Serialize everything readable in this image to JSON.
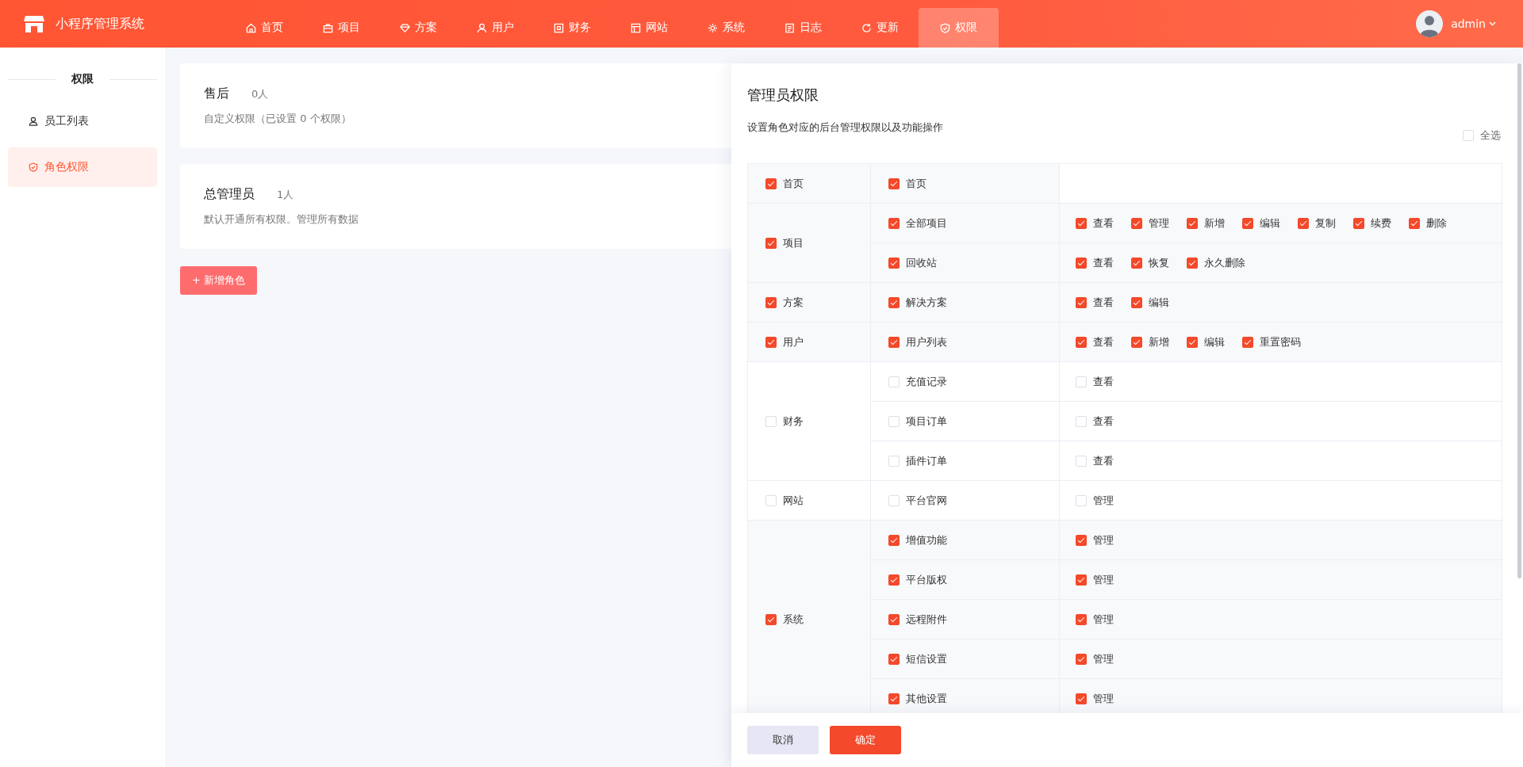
{
  "app": {
    "title": "小程序管理系统"
  },
  "nav": [
    {
      "label": "首页",
      "selected": false
    },
    {
      "label": "项目",
      "selected": false
    },
    {
      "label": "方案",
      "selected": false
    },
    {
      "label": "用户",
      "selected": false
    },
    {
      "label": "财务",
      "selected": false
    },
    {
      "label": "网站",
      "selected": false
    },
    {
      "label": "系统",
      "selected": false
    },
    {
      "label": "日志",
      "selected": false
    },
    {
      "label": "更新",
      "selected": false
    },
    {
      "label": "权限",
      "selected": true
    }
  ],
  "user": {
    "name": "admin"
  },
  "sidebar": {
    "title": "权限",
    "items": [
      {
        "label": "员工列表",
        "selected": false
      },
      {
        "label": "角色权限",
        "selected": true
      }
    ]
  },
  "roles": [
    {
      "name": "售后",
      "count": "0人",
      "description": "自定义权限（已设置 0 个权限）"
    },
    {
      "name": "总管理员",
      "count": "1人",
      "description": "默认开通所有权限。管理所有数据"
    }
  ],
  "add_button": "+ 新增角色",
  "drawer": {
    "title": "管理员权限",
    "subtitle": "设置角色对应的后台管理权限以及功能操作",
    "select_all": {
      "label": "全选",
      "checked": false
    },
    "groups": [
      {
        "label": "首页",
        "checked": true,
        "items": [
          {
            "label": "首页",
            "checked": true
          }
        ]
      },
      {
        "label": "项目",
        "checked": true,
        "items": [
          {
            "label": "全部项目",
            "checked": true,
            "actions": [
              {
                "label": "查看",
                "checked": true
              },
              {
                "label": "管理",
                "checked": true
              },
              {
                "label": "新增",
                "checked": true
              },
              {
                "label": "编辑",
                "checked": true
              },
              {
                "label": "复制",
                "checked": true
              },
              {
                "label": "续费",
                "checked": true
              },
              {
                "label": "删除",
                "checked": true
              }
            ]
          },
          {
            "label": "回收站",
            "checked": true,
            "actions": [
              {
                "label": "查看",
                "checked": true
              },
              {
                "label": "恢复",
                "checked": true
              },
              {
                "label": "永久删除",
                "checked": true
              }
            ]
          }
        ]
      },
      {
        "label": "方案",
        "checked": true,
        "items": [
          {
            "label": "解决方案",
            "checked": true,
            "actions": [
              {
                "label": "查看",
                "checked": true
              },
              {
                "label": "编辑",
                "checked": true
              }
            ]
          }
        ]
      },
      {
        "label": "用户",
        "checked": true,
        "items": [
          {
            "label": "用户列表",
            "checked": true,
            "actions": [
              {
                "label": "查看",
                "checked": true
              },
              {
                "label": "新增",
                "checked": true
              },
              {
                "label": "编辑",
                "checked": true
              },
              {
                "label": "重置密码",
                "checked": true
              }
            ]
          }
        ]
      },
      {
        "label": "财务",
        "checked": false,
        "items": [
          {
            "label": "充值记录",
            "checked": false,
            "actions": [
              {
                "label": "查看",
                "checked": false
              }
            ]
          },
          {
            "label": "项目订单",
            "checked": false,
            "actions": [
              {
                "label": "查看",
                "checked": false
              }
            ]
          },
          {
            "label": "插件订单",
            "checked": false,
            "actions": [
              {
                "label": "查看",
                "checked": false
              }
            ]
          }
        ]
      },
      {
        "label": "网站",
        "checked": false,
        "items": [
          {
            "label": "平台官网",
            "checked": false,
            "actions": [
              {
                "label": "管理",
                "checked": false
              }
            ]
          }
        ]
      },
      {
        "label": "系统",
        "checked": true,
        "items": [
          {
            "label": "增值功能",
            "checked": true,
            "actions": [
              {
                "label": "管理",
                "checked": true
              }
            ]
          },
          {
            "label": "平台版权",
            "checked": true,
            "actions": [
              {
                "label": "管理",
                "checked": true
              }
            ]
          },
          {
            "label": "远程附件",
            "checked": true,
            "actions": [
              {
                "label": "管理",
                "checked": true
              }
            ]
          },
          {
            "label": "短信设置",
            "checked": true,
            "actions": [
              {
                "label": "管理",
                "checked": true
              }
            ]
          },
          {
            "label": "其他设置",
            "checked": true,
            "actions": [
              {
                "label": "管理",
                "checked": true
              }
            ]
          }
        ]
      }
    ],
    "buttons": {
      "cancel": "取消",
      "confirm": "确定"
    }
  }
}
